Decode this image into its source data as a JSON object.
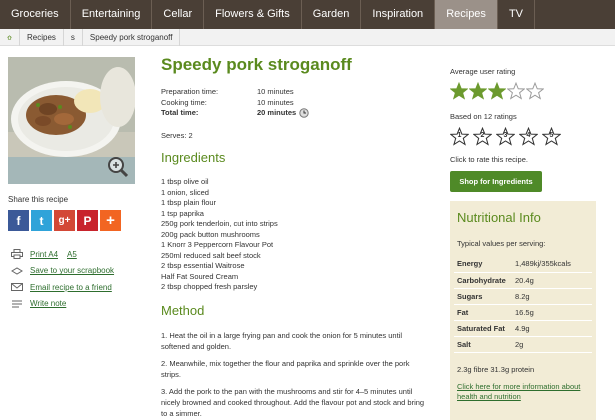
{
  "nav": {
    "items": [
      "Groceries",
      "Entertaining",
      "Cellar",
      "Flowers & Gifts",
      "Garden",
      "Inspiration",
      "Recipes",
      "TV"
    ],
    "active": "Recipes"
  },
  "breadcrumb": {
    "items": [
      "Recipes",
      "s",
      "Speedy pork stroganoff"
    ]
  },
  "recipe": {
    "title": "Speedy pork stroganoff",
    "times": [
      {
        "label": "Preparation time:",
        "value": "10 minutes"
      },
      {
        "label": "Cooking time:",
        "value": "10 minutes"
      },
      {
        "label": "Total time:",
        "value": "20 minutes"
      }
    ],
    "serves": "Serves: 2",
    "ingredients_heading": "Ingredients",
    "ingredients": [
      "1 tbsp olive oil",
      "1 onion, sliced",
      "1 tbsp plain flour",
      "1 tsp paprika",
      "250g pork tenderloin, cut into strips",
      "200g pack button mushrooms",
      "1 Knorr 3 Peppercorn Flavour Pot",
      "250ml reduced salt beef stock",
      "2 tbsp essential Waitrose",
      "Half Fat Soured Cream",
      "2 tbsp chopped fresh parsley"
    ],
    "method_heading": "Method",
    "method": [
      "1. Heat the oil in a large frying pan and cook the onion for 5 minutes until softened and golden.",
      "2. Meanwhile, mix together the flour and paprika and sprinkle over the pork strips.",
      "3. Add the pork to the pan with the mushrooms and stir for 4–5 minutes until nicely browned and cooked throughout. Add the flavour pot and stock and bring to a simmer."
    ]
  },
  "share": {
    "title": "Share this recipe",
    "buttons": [
      {
        "name": "facebook",
        "glyph": "f",
        "color": "#3b5998"
      },
      {
        "name": "twitter",
        "glyph": "t",
        "color": "#2fa3d9"
      },
      {
        "name": "google-plus",
        "glyph": "g+",
        "color": "#d34836"
      },
      {
        "name": "pinterest",
        "glyph": "P",
        "color": "#c8232c"
      },
      {
        "name": "more",
        "glyph": "+",
        "color": "#f26522"
      }
    ]
  },
  "links": {
    "print": "Print A4",
    "print_a5": "A5",
    "scrapbook": "Save to your scrapbook",
    "email": "Email recipe to a friend",
    "note": "Write note"
  },
  "rating": {
    "average_label": "Average user rating",
    "average_value": 3,
    "max": 5,
    "based_on": "Based on 12 ratings",
    "rate_numbers": [
      "1",
      "2",
      "3",
      "4",
      "5"
    ],
    "click_to_rate": "Click to rate this recipe.",
    "shop_button": "Shop for Ingredients",
    "star_color": "#6c9a2e"
  },
  "nutrition": {
    "title": "Nutritional Info",
    "subtitle": "Typical values per serving:",
    "rows": [
      {
        "label": "Energy",
        "value": "1,489kj/355kcals"
      },
      {
        "label": "Carbohydrate",
        "value": "20.4g"
      },
      {
        "label": "Sugars",
        "value": "8.2g"
      },
      {
        "label": "Fat",
        "value": "16.5g"
      },
      {
        "label": "Saturated Fat",
        "value": "4.9g"
      },
      {
        "label": "Salt",
        "value": "2g"
      }
    ],
    "extra": "2.3g fibre 31.3g protein",
    "link": "Click here for more information about health and nutrition"
  }
}
